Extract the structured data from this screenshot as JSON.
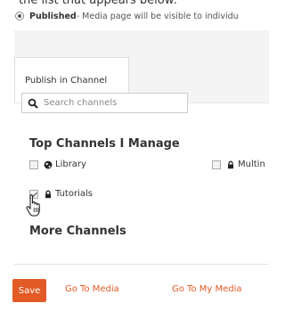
{
  "top_text": "the list that appears below:",
  "visibility": {
    "published_label": "Published",
    "published_rest": " - Media page will be visible to individu"
  },
  "tab": {
    "label": "Publish in Channel"
  },
  "search": {
    "placeholder": "Search channels"
  },
  "top_channels": {
    "heading": "Top Channels I Manage",
    "items": [
      {
        "label": "Library",
        "icon": "globe-icon",
        "checked": false
      },
      {
        "label": "Multin",
        "icon": "lock-icon",
        "checked": false
      },
      {
        "label": "Tutorials",
        "icon": "lock-icon",
        "checked": true
      }
    ]
  },
  "more_channels": {
    "heading": "More Channels"
  },
  "footer": {
    "save_label": "Save",
    "go_to_media_label": "Go To Media",
    "go_to_my_media_label": "Go To My Media"
  },
  "colors": {
    "accent": "#e25b26",
    "tab_bar_bg": "#f4f4f4"
  }
}
